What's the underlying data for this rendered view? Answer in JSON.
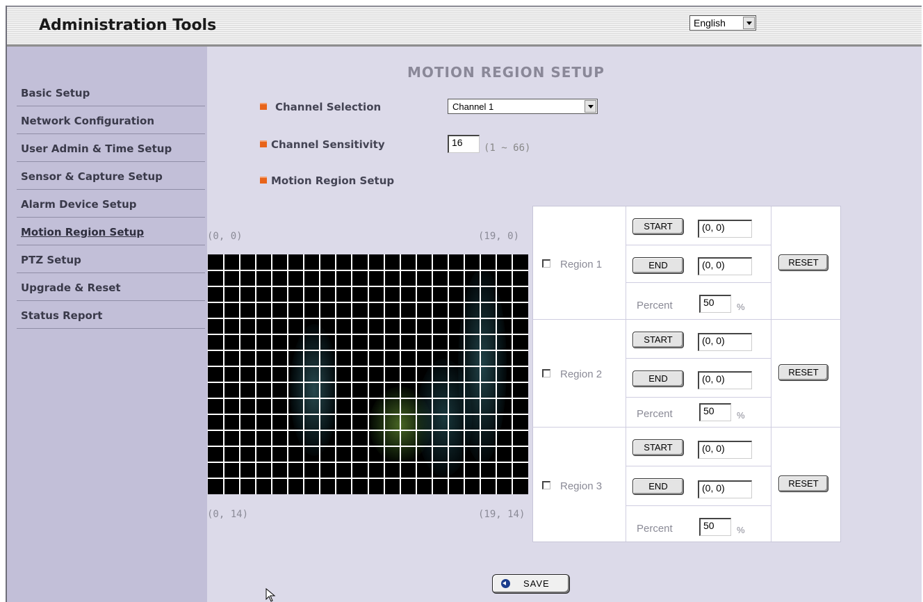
{
  "header": {
    "title": "Administration Tools",
    "language": "English"
  },
  "sidebar": {
    "items": [
      {
        "label": "Basic Setup"
      },
      {
        "label": "Network Configuration"
      },
      {
        "label": "User Admin & Time Setup"
      },
      {
        "label": "Sensor & Capture Setup"
      },
      {
        "label": "Alarm Device Setup"
      },
      {
        "label": "Motion Region Setup",
        "active": true
      },
      {
        "label": "PTZ Setup"
      },
      {
        "label": "Upgrade & Reset"
      },
      {
        "label": "Status Report"
      }
    ]
  },
  "main": {
    "title": "MOTION REGION SETUP",
    "channel_selection": {
      "label": "Channel Selection",
      "value": "Channel 1"
    },
    "channel_sensitivity": {
      "label": "Channel Sensitivity",
      "value": "16",
      "range_hint": "(1 ~ 66)"
    },
    "motion_region_label": "Motion Region Setup",
    "grid": {
      "corner_top_left": "(0, 0)",
      "corner_top_right": "(19, 0)",
      "corner_bottom_left": "(0, 14)",
      "corner_bottom_right": "(19, 14)"
    },
    "regions": [
      {
        "label": "Region 1",
        "start_label": "START",
        "start_value": "(0, 0)",
        "end_label": "END",
        "end_value": "(0, 0)",
        "percent_label": "Percent",
        "percent_value": "50",
        "percent_unit": "%",
        "reset_label": "RESET"
      },
      {
        "label": "Region 2",
        "start_label": "START",
        "start_value": "(0, 0)",
        "end_label": "END",
        "end_value": "(0, 0)",
        "percent_label": "Percent",
        "percent_value": "50",
        "percent_unit": "%",
        "reset_label": "RESET"
      },
      {
        "label": "Region 3",
        "start_label": "START",
        "start_value": "(0, 0)",
        "end_label": "END",
        "end_value": "(0, 0)",
        "percent_label": "Percent",
        "percent_value": "50",
        "percent_unit": "%",
        "reset_label": "RESET"
      }
    ],
    "save_label": "SAVE"
  },
  "colors": {
    "accent_bullet": "#e8641a",
    "sidebar_bg": "#c2bfd8",
    "main_bg": "#dcdae9",
    "grid_line": "#ffffff"
  }
}
